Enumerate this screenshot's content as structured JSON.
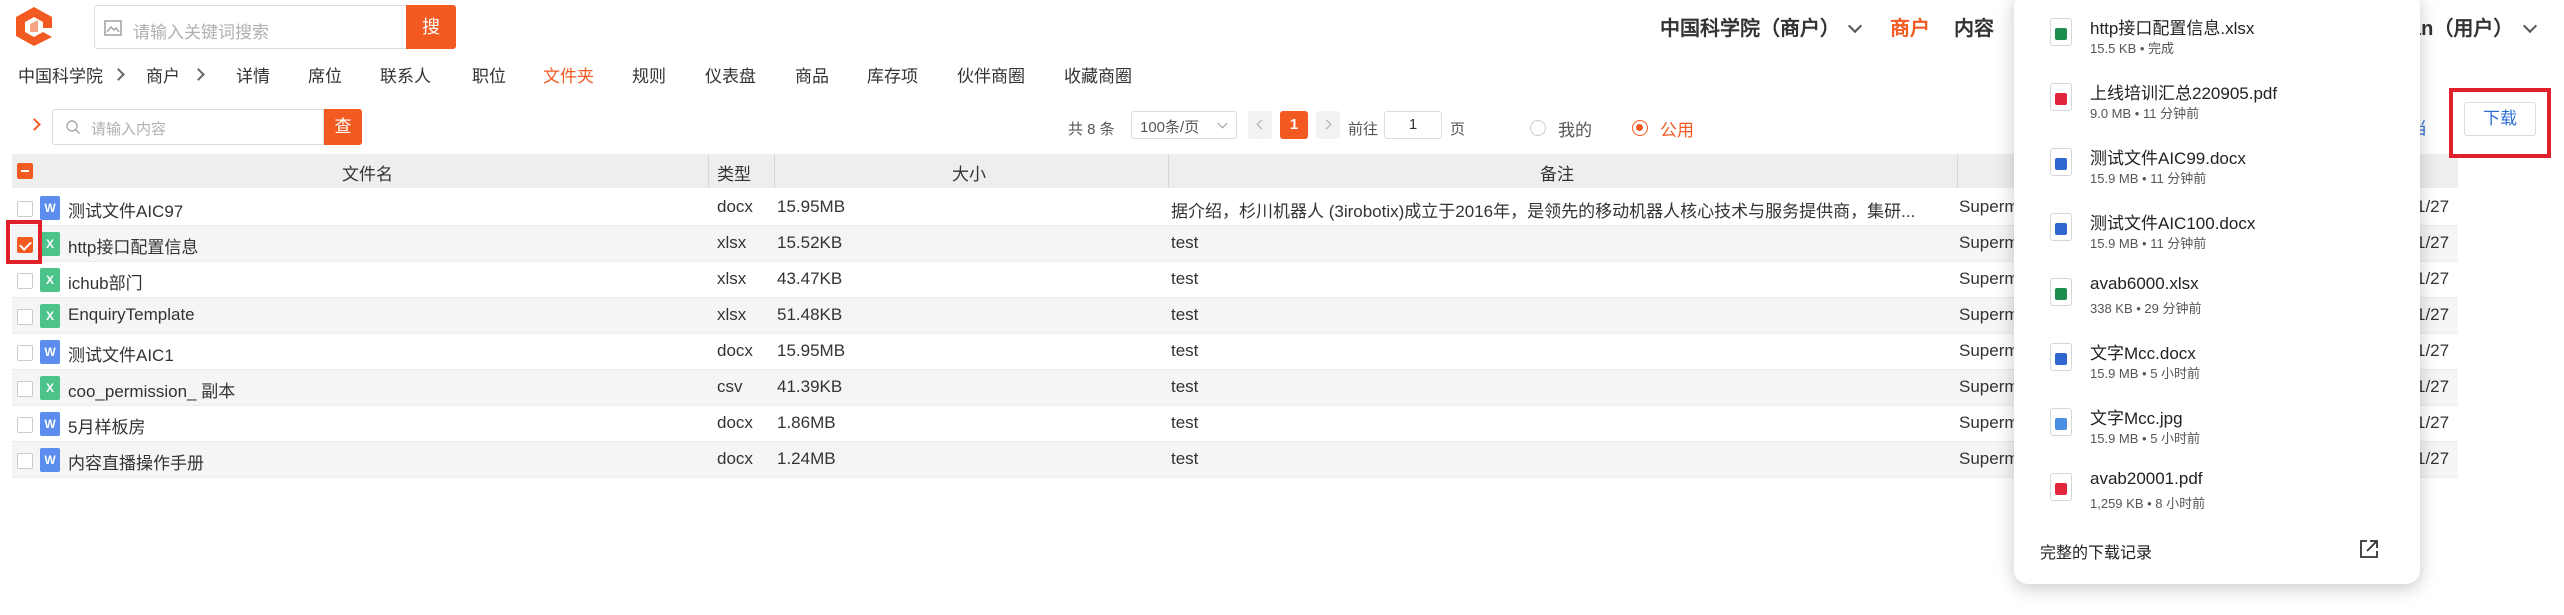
{
  "header": {
    "search_placeholder": "请输入关键词搜索",
    "search_button": "搜",
    "org_menu": "中国科学院（商户）",
    "nav_merchant": "商户",
    "nav_content": "内容",
    "user_menu": "an（用户）"
  },
  "breadcrumb": [
    "中国科学院",
    "商户"
  ],
  "tabs": [
    {
      "label": "详情",
      "active": false
    },
    {
      "label": "席位",
      "active": false
    },
    {
      "label": "联系人",
      "active": false
    },
    {
      "label": "职位",
      "active": false
    },
    {
      "label": "文件夹",
      "active": true
    },
    {
      "label": "规则",
      "active": false
    },
    {
      "label": "仪表盘",
      "active": false
    },
    {
      "label": "商品",
      "active": false
    },
    {
      "label": "库存项",
      "active": false
    },
    {
      "label": "伙伴商圈",
      "active": false
    },
    {
      "label": "收藏商圈",
      "active": false
    }
  ],
  "toolbar": {
    "filter_placeholder": "请输入内容",
    "filter_button": "查",
    "total": "共 8 条",
    "page_size": "100条/页",
    "current_page": "1",
    "goto_label": "前往",
    "goto_value": "1",
    "goto_suffix": "页",
    "radio_mine": "我的",
    "radio_public": "公用",
    "partial_button": "当",
    "download_button": "下载"
  },
  "table": {
    "headers": {
      "name": "文件名",
      "type": "类型",
      "size": "大小",
      "note": "备注"
    },
    "rows": [
      {
        "name": "测试文件AIC97",
        "type": "docx",
        "size": "15.95MB",
        "note": "据介绍，杉川机器人 (3irobotix)成立于2016年，是领先的移动机器人核心技术与服务提供商，集研...",
        "owner": "Superm",
        "date_tail": "1/27",
        "checked": false,
        "icon": "W"
      },
      {
        "name": "http接口配置信息",
        "type": "xlsx",
        "size": "15.52KB",
        "note": "test",
        "owner": "Superm",
        "date_tail": "1/27",
        "checked": true,
        "icon": "X"
      },
      {
        "name": "ichub部门",
        "type": "xlsx",
        "size": "43.47KB",
        "note": "test",
        "owner": "Superm",
        "date_tail": "1/27",
        "checked": false,
        "icon": "X"
      },
      {
        "name": "EnquiryTemplate",
        "type": "xlsx",
        "size": "51.48KB",
        "note": "test",
        "owner": "Superm",
        "date_tail": "1/27",
        "checked": false,
        "icon": "X"
      },
      {
        "name": "测试文件AIC1",
        "type": "docx",
        "size": "15.95MB",
        "note": "test",
        "owner": "Superm",
        "date_tail": "1/27",
        "checked": false,
        "icon": "W"
      },
      {
        "name": "coo_permission_ 副本",
        "type": "csv",
        "size": "41.39KB",
        "note": "test",
        "owner": "Superm",
        "date_tail": "1/27",
        "checked": false,
        "icon": "X"
      },
      {
        "name": "5月样板房",
        "type": "docx",
        "size": "1.86MB",
        "note": "test",
        "owner": "Superm",
        "date_tail": "1/27",
        "checked": false,
        "icon": "W"
      },
      {
        "name": "内容直播操作手册",
        "type": "docx",
        "size": "1.24MB",
        "note": "test",
        "owner": "Superm",
        "date_tail": "1/27",
        "checked": false,
        "icon": "W"
      }
    ]
  },
  "downloads": {
    "items": [
      {
        "name": "http接口配置信息.xlsx",
        "meta": "15.5 KB • 完成",
        "kind": "xlsx",
        "color": "#1e8e4e"
      },
      {
        "name": "上线培训汇总220905.pdf",
        "meta": "9.0 MB • 11 分钟前",
        "kind": "pdf",
        "color": "#e2263b"
      },
      {
        "name": "测试文件AIC99.docx",
        "meta": "15.9 MB • 11 分钟前",
        "kind": "docx",
        "color": "#2f66d0"
      },
      {
        "name": "测试文件AIC100.docx",
        "meta": "15.9 MB • 11 分钟前",
        "kind": "docx",
        "color": "#2f66d0"
      },
      {
        "name": "avab6000.xlsx",
        "meta": "338 KB • 29 分钟前",
        "kind": "xlsx",
        "color": "#1e8e4e"
      },
      {
        "name": "文字Mcc.docx",
        "meta": "15.9 MB • 5 小时前",
        "kind": "docx",
        "color": "#2f66d0"
      },
      {
        "name": "文字Mcc.jpg",
        "meta": "15.9 MB • 5 小时前",
        "kind": "jpg",
        "color": "#4a90e2"
      },
      {
        "name": "avab20001.pdf",
        "meta": "1,259 KB • 8 小时前",
        "kind": "pdf",
        "color": "#e2263b"
      }
    ],
    "history_link": "完整的下载记录"
  },
  "colors": {
    "accent": "#f25a22",
    "annotation": "#e0202a",
    "link": "#2d6fd6"
  }
}
